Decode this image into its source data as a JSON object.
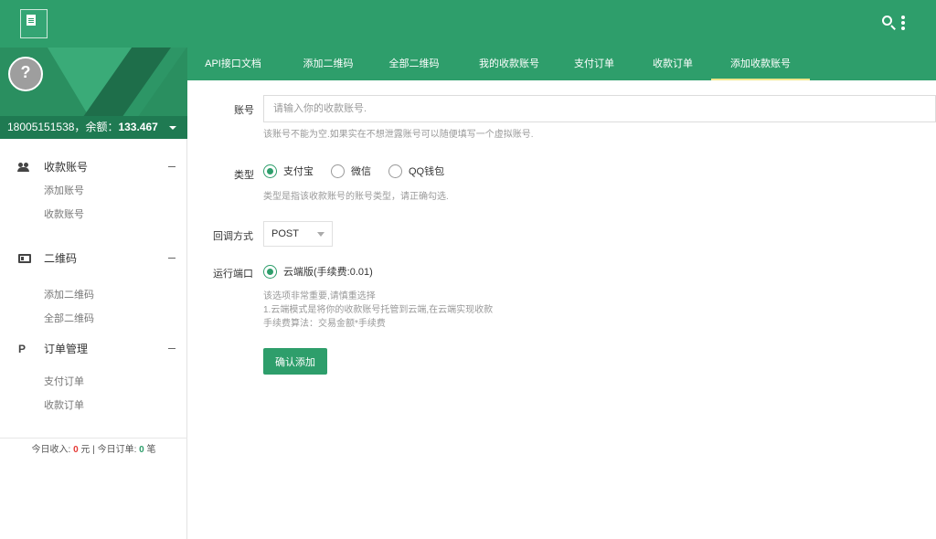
{
  "topbar": {
    "search_icon": "search-icon",
    "more_icon": "more-vert-icon",
    "brand_color": "#2e9e6b"
  },
  "sidebar": {
    "account": "18005151538",
    "balance_label": "余额：",
    "balance_value": "133.467",
    "groups": [
      {
        "label": "收款账号",
        "icon": "people-icon",
        "items": [
          "添加账号",
          "收款账号"
        ]
      },
      {
        "label": "二维码",
        "icon": "card-icon",
        "items": [
          "添加二维码",
          "全部二维码"
        ]
      },
      {
        "label": "订单管理",
        "icon": "paypal-icon",
        "items": [
          "支付订单",
          "收款订单"
        ]
      }
    ],
    "footer": {
      "income_label": "今日收入:",
      "income_value": "0",
      "income_unit": "元",
      "separator": "|",
      "orders_label": "今日订单:",
      "orders_value": "0",
      "orders_unit": "笔"
    }
  },
  "tabs": [
    "API接口文档",
    "添加二维码",
    "全部二维码",
    "我的收款账号",
    "支付订单",
    "收款订单",
    "添加收款账号"
  ],
  "form": {
    "account_label": "账号",
    "account_placeholder": "请输入你的收款账号.",
    "account_help": "该账号不能为空.如果实在不想泄露账号可以随便填写一个虚拟账号.",
    "type_label": "类型",
    "type_options": [
      "支付宝",
      "微信",
      "QQ钱包"
    ],
    "type_selected": "支付宝",
    "type_help": "类型是指该收款账号的账号类型，请正确勾选.",
    "callback_label": "回调方式",
    "callback_value": "POST",
    "port_label": "运行端口",
    "port_option": "云端版(手续费:0.01)",
    "port_help_1": "该选项非常重要,请慎重选择",
    "port_help_2": "1.云端模式是将你的收款账号托管到云端,在云端实现收款",
    "port_help_3": "手续费算法：交易金额*手续费",
    "submit_label": "确认添加"
  }
}
